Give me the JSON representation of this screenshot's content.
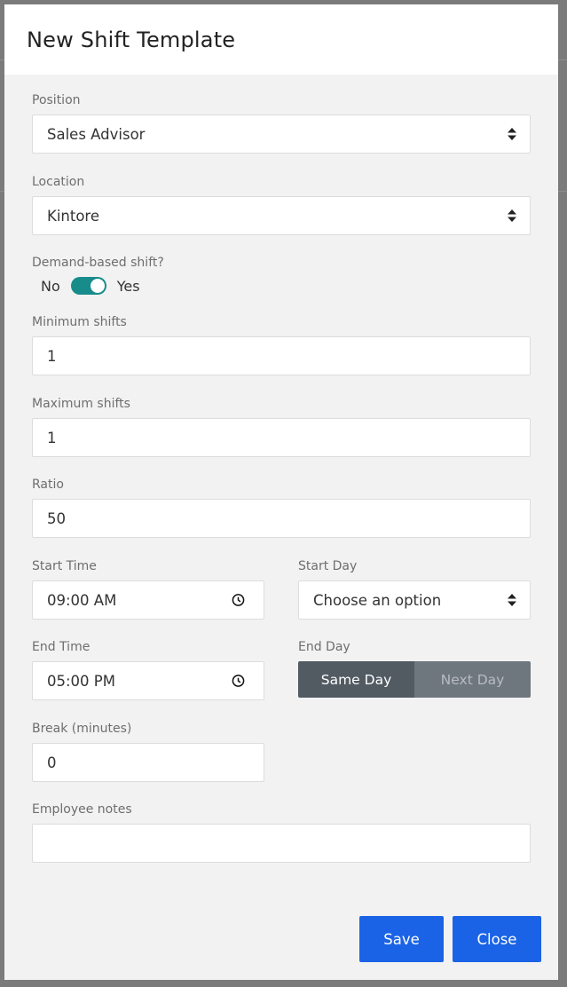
{
  "modal": {
    "title": "New Shift Template"
  },
  "position": {
    "label": "Position",
    "value": "Sales Advisor"
  },
  "location": {
    "label": "Location",
    "value": "Kintore"
  },
  "demand": {
    "label": "Demand-based shift?",
    "off_label": "No",
    "on_label": "Yes",
    "enabled": true
  },
  "min_shifts": {
    "label": "Minimum shifts",
    "value": "1"
  },
  "max_shifts": {
    "label": "Maximum shifts",
    "value": "1"
  },
  "ratio": {
    "label": "Ratio",
    "value": "50"
  },
  "start_time": {
    "label": "Start Time",
    "value": "09:00 AM"
  },
  "start_day": {
    "label": "Start Day",
    "value": "Choose an option"
  },
  "end_time": {
    "label": "End Time",
    "value": "05:00 PM"
  },
  "end_day": {
    "label": "End Day",
    "options": [
      "Same Day",
      "Next Day"
    ],
    "selected": "Same Day"
  },
  "break": {
    "label": "Break (minutes)",
    "value": "0"
  },
  "notes": {
    "label": "Employee notes",
    "value": ""
  },
  "actions": {
    "save": "Save",
    "close": "Close"
  },
  "colors": {
    "toggle": "#178c8b",
    "primary": "#1a63e6",
    "segment_active": "#525a62",
    "segment_inactive": "#6f777e"
  },
  "icons": {
    "select": "updown-arrows-icon",
    "time": "clock-icon"
  }
}
